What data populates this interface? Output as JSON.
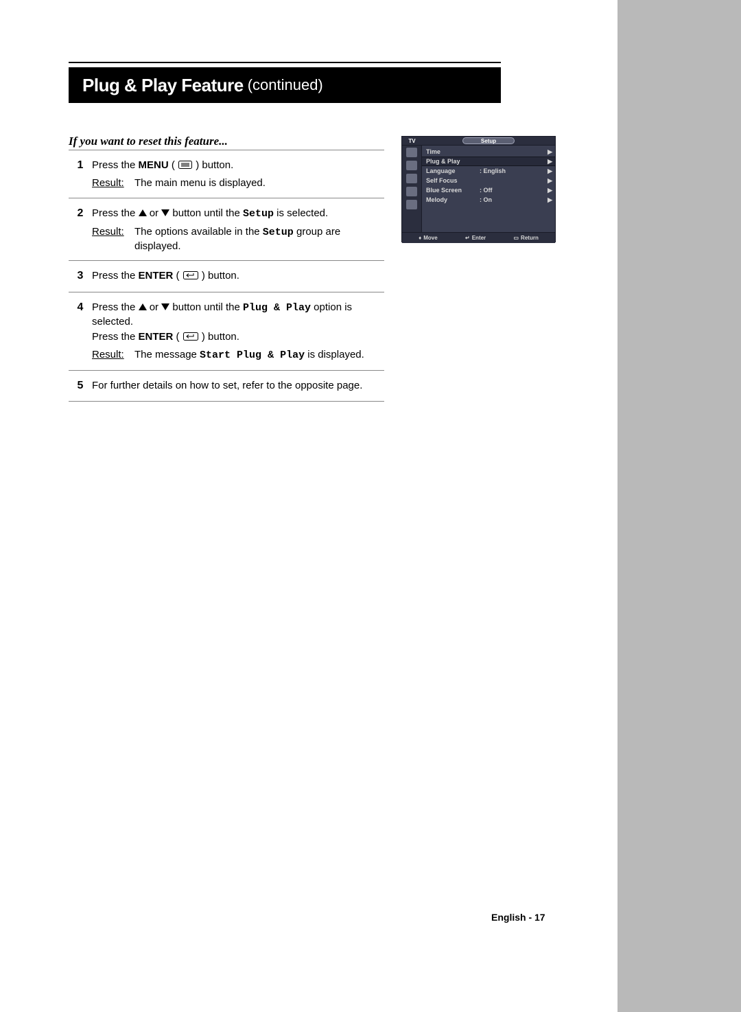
{
  "header": {
    "title_main": "Plug & Play Feature",
    "title_sub": "(continued)"
  },
  "subtitle": "If you want to reset this feature...",
  "steps": [
    {
      "num": "1",
      "parts": {
        "p1": "Press the ",
        "bold1": "MENU",
        "p2": " ( ",
        "icon1": "menu-icon",
        "p3": " ) button.",
        "result": "The main menu is displayed."
      }
    },
    {
      "num": "2",
      "parts": {
        "p1": "Press the ",
        "icon1": "up",
        "p2": " or ",
        "icon2": "down",
        "p3": " button until the ",
        "mono1": "Setup",
        "p4": "  is selected.",
        "result_pre": "The options available in the ",
        "result_mono": "Setup",
        "result_post": " group are displayed."
      }
    },
    {
      "num": "3",
      "parts": {
        "p1": "Press the ",
        "bold1": "ENTER",
        "p2": " ( ",
        "icon1": "enter-icon",
        "p3": " ) button."
      }
    },
    {
      "num": "4",
      "parts": {
        "p1": "Press the ",
        "icon1": "up",
        "p2": " or ",
        "icon2": "down",
        "p3": " button until the ",
        "mono1": "Plug & Play",
        "p4": " option is selected.",
        "line2_p1": "Press the ",
        "line2_bold1": "ENTER",
        "line2_p2": " ( ",
        "line2_icon1": "enter-icon",
        "line2_p3": " ) button.",
        "result_pre": "The message ",
        "result_mono": "Start Plug & Play",
        "result_post": " is displayed."
      }
    },
    {
      "num": "5",
      "parts": {
        "p1": "For further details on how to set, refer to the opposite page."
      }
    }
  ],
  "result_label": "Result:",
  "osd": {
    "tv": "TV",
    "title": "Setup",
    "rows": [
      {
        "label": "Time",
        "value": ""
      },
      {
        "label": "Plug & Play",
        "value": ""
      },
      {
        "label": "Language",
        "value": ":  English"
      },
      {
        "label": "Self Focus",
        "value": ""
      },
      {
        "label": "Blue Screen",
        "value": ":  Off"
      },
      {
        "label": "Melody",
        "value": ":  On"
      }
    ],
    "bottom": {
      "move": "Move",
      "enter": "Enter",
      "return": "Return"
    }
  },
  "footer": "English - 17"
}
